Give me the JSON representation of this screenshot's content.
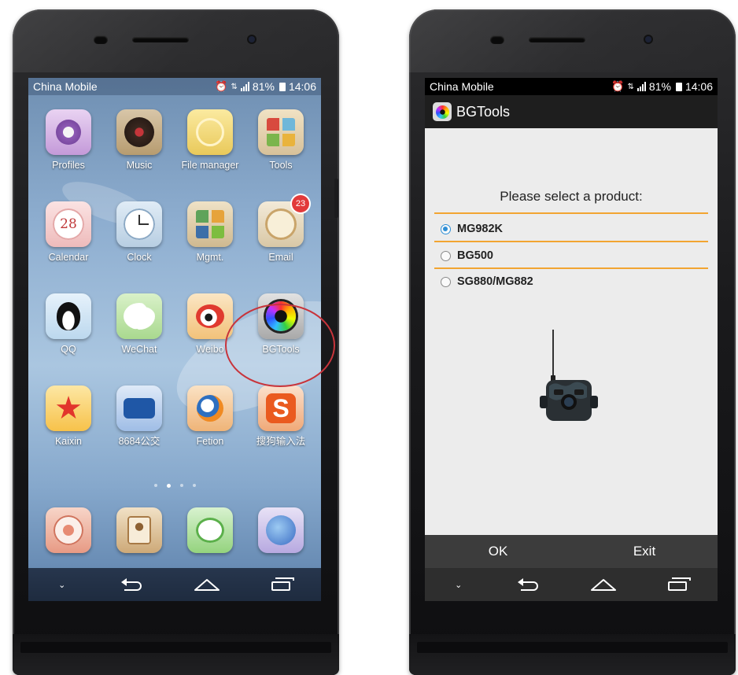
{
  "phone_a": {
    "status": {
      "carrier": "China Mobile",
      "battery": "81%",
      "time": "14:06"
    },
    "apps": [
      {
        "label": "Profiles",
        "icon": "profiles-icon"
      },
      {
        "label": "Music",
        "icon": "music-icon"
      },
      {
        "label": "File manager",
        "icon": "file-manager-icon"
      },
      {
        "label": "Tools",
        "icon": "tools-icon"
      },
      {
        "label": "Calendar",
        "icon": "calendar-icon"
      },
      {
        "label": "Clock",
        "icon": "clock-icon"
      },
      {
        "label": "Mgmt.",
        "icon": "mgmt-icon"
      },
      {
        "label": "Email",
        "icon": "email-icon",
        "badge": "23"
      },
      {
        "label": "QQ",
        "icon": "qq-icon"
      },
      {
        "label": "WeChat",
        "icon": "wechat-icon"
      },
      {
        "label": "Weibo",
        "icon": "weibo-icon"
      },
      {
        "label": "BGTools",
        "icon": "bgtools-icon"
      },
      {
        "label": "Kaixin",
        "icon": "kaixin-icon"
      },
      {
        "label": "8684公交",
        "icon": "8684-bus-icon"
      },
      {
        "label": "Fetion",
        "icon": "fetion-icon"
      },
      {
        "label": "搜狗输入法",
        "icon": "sogou-input-icon"
      }
    ],
    "dock": [
      {
        "icon": "dialer-icon"
      },
      {
        "icon": "contacts-icon"
      },
      {
        "icon": "messaging-icon"
      },
      {
        "icon": "browser-icon"
      }
    ],
    "highlight_color": "#c8343b"
  },
  "phone_b": {
    "status": {
      "carrier": "China Mobile",
      "battery": "81%",
      "time": "14:06"
    },
    "app_title": "BGTools",
    "prompt": "Please select a product:",
    "options": [
      {
        "label": "MG982K",
        "checked": true
      },
      {
        "label": "BG500",
        "checked": false
      },
      {
        "label": "SG880/MG882",
        "checked": false
      }
    ],
    "ok_label": "OK",
    "exit_label": "Exit",
    "accent_color": "#f2a531",
    "radio_color": "#2f8fd6"
  }
}
